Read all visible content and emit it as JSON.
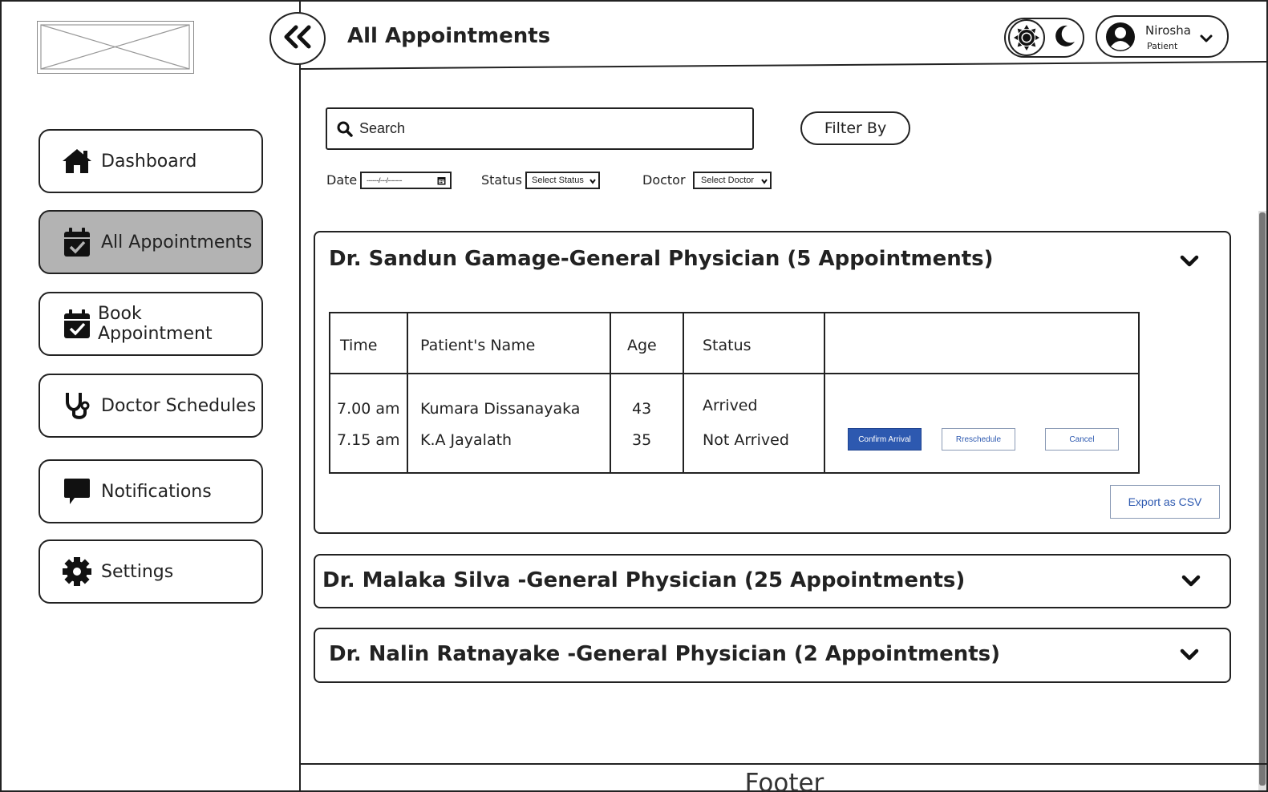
{
  "header": {
    "title": "All Appointments",
    "user_name": "Nirosha",
    "user_role": "Patient"
  },
  "sidebar": {
    "items": [
      {
        "label": "Dashboard",
        "icon": "home-icon",
        "active": false
      },
      {
        "label": "All Appointments",
        "icon": "calendar-check-icon",
        "active": true
      },
      {
        "label": "Book Appointment",
        "icon": "calendar-check-icon",
        "active": false
      },
      {
        "label": "Doctor Schedules",
        "icon": "stethoscope-icon",
        "active": false
      },
      {
        "label": "Notifications",
        "icon": "message-icon",
        "active": false
      },
      {
        "label": "Settings",
        "icon": "gear-icon",
        "active": false
      }
    ]
  },
  "search": {
    "placeholder": "Search",
    "filter_label": "Filter By"
  },
  "filters": {
    "date_label": "Date",
    "date_value": "------/---/-------",
    "status_label": "Status",
    "status_value": "Select Status",
    "doctor_label": "Doctor",
    "doctor_value": "Select Doctor"
  },
  "doctors": [
    {
      "title": "Dr. Sandun Gamage-General Physician (5 Appointments)",
      "expanded": true,
      "table": {
        "headers": [
          "Time",
          "Patient's Name",
          "Age",
          "Status"
        ],
        "rows": [
          {
            "time": "7.00 am",
            "name": "Kumara Dissanayaka",
            "age": "43",
            "status": "Arrived"
          },
          {
            "time": "7.15 am",
            "name": "K.A Jayalath",
            "age": "35",
            "status": "Not Arrived"
          }
        ]
      },
      "actions": {
        "confirm": "Confirm Arrival",
        "reschedule": "Rreschedule",
        "cancel": "Cancel"
      },
      "export_label": "Export as CSV"
    },
    {
      "title": "Dr. Malaka Silva -General Physician (25 Appointments)",
      "expanded": false
    },
    {
      "title": "Dr. Nalin Ratnayake -General Physician (2 Appointments)",
      "expanded": false
    }
  ],
  "footer": {
    "label": "Footer"
  },
  "colors": {
    "primary_button": "#2d59b0",
    "active_nav": "#b3b3b3",
    "outline": "#222222"
  }
}
